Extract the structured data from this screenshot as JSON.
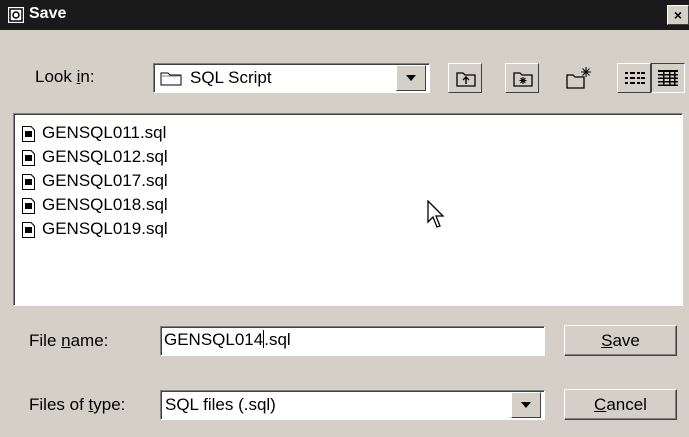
{
  "window": {
    "title": "Save",
    "close_glyph": "×"
  },
  "lookin": {
    "label_pre": "Look ",
    "label_key": "i",
    "label_post": "n:",
    "value": "SQL Script",
    "folder_icon": "folder-icon"
  },
  "toolbar": {
    "up_icon": "up-one-level-icon",
    "home_icon": "desktop-home-icon",
    "new_folder_icon": "new-folder-icon",
    "list_icon": "list-view-icon",
    "details_icon": "details-view-icon"
  },
  "files": [
    {
      "name": "GENSQL011.sql"
    },
    {
      "name": "GENSQL012.sql"
    },
    {
      "name": "GENSQL017.sql"
    },
    {
      "name": "GENSQL018.sql"
    },
    {
      "name": "GENSQL019.sql"
    }
  ],
  "filename": {
    "label_pre": "File ",
    "label_key": "n",
    "label_post": "ame:",
    "value_before_caret": "GENSQL014",
    "value_after_caret": ".sql"
  },
  "filetype": {
    "label_pre": "Files of ",
    "label_key": "t",
    "label_post": "ype:",
    "value": "SQL files (.sql)"
  },
  "buttons": {
    "save_key": "S",
    "save_rest": "ave",
    "cancel_key": "C",
    "cancel_rest": "ancel"
  },
  "colors": {
    "face": "#d4d0c8",
    "titlebar": "#1a1a1a",
    "field": "#ffffff"
  }
}
